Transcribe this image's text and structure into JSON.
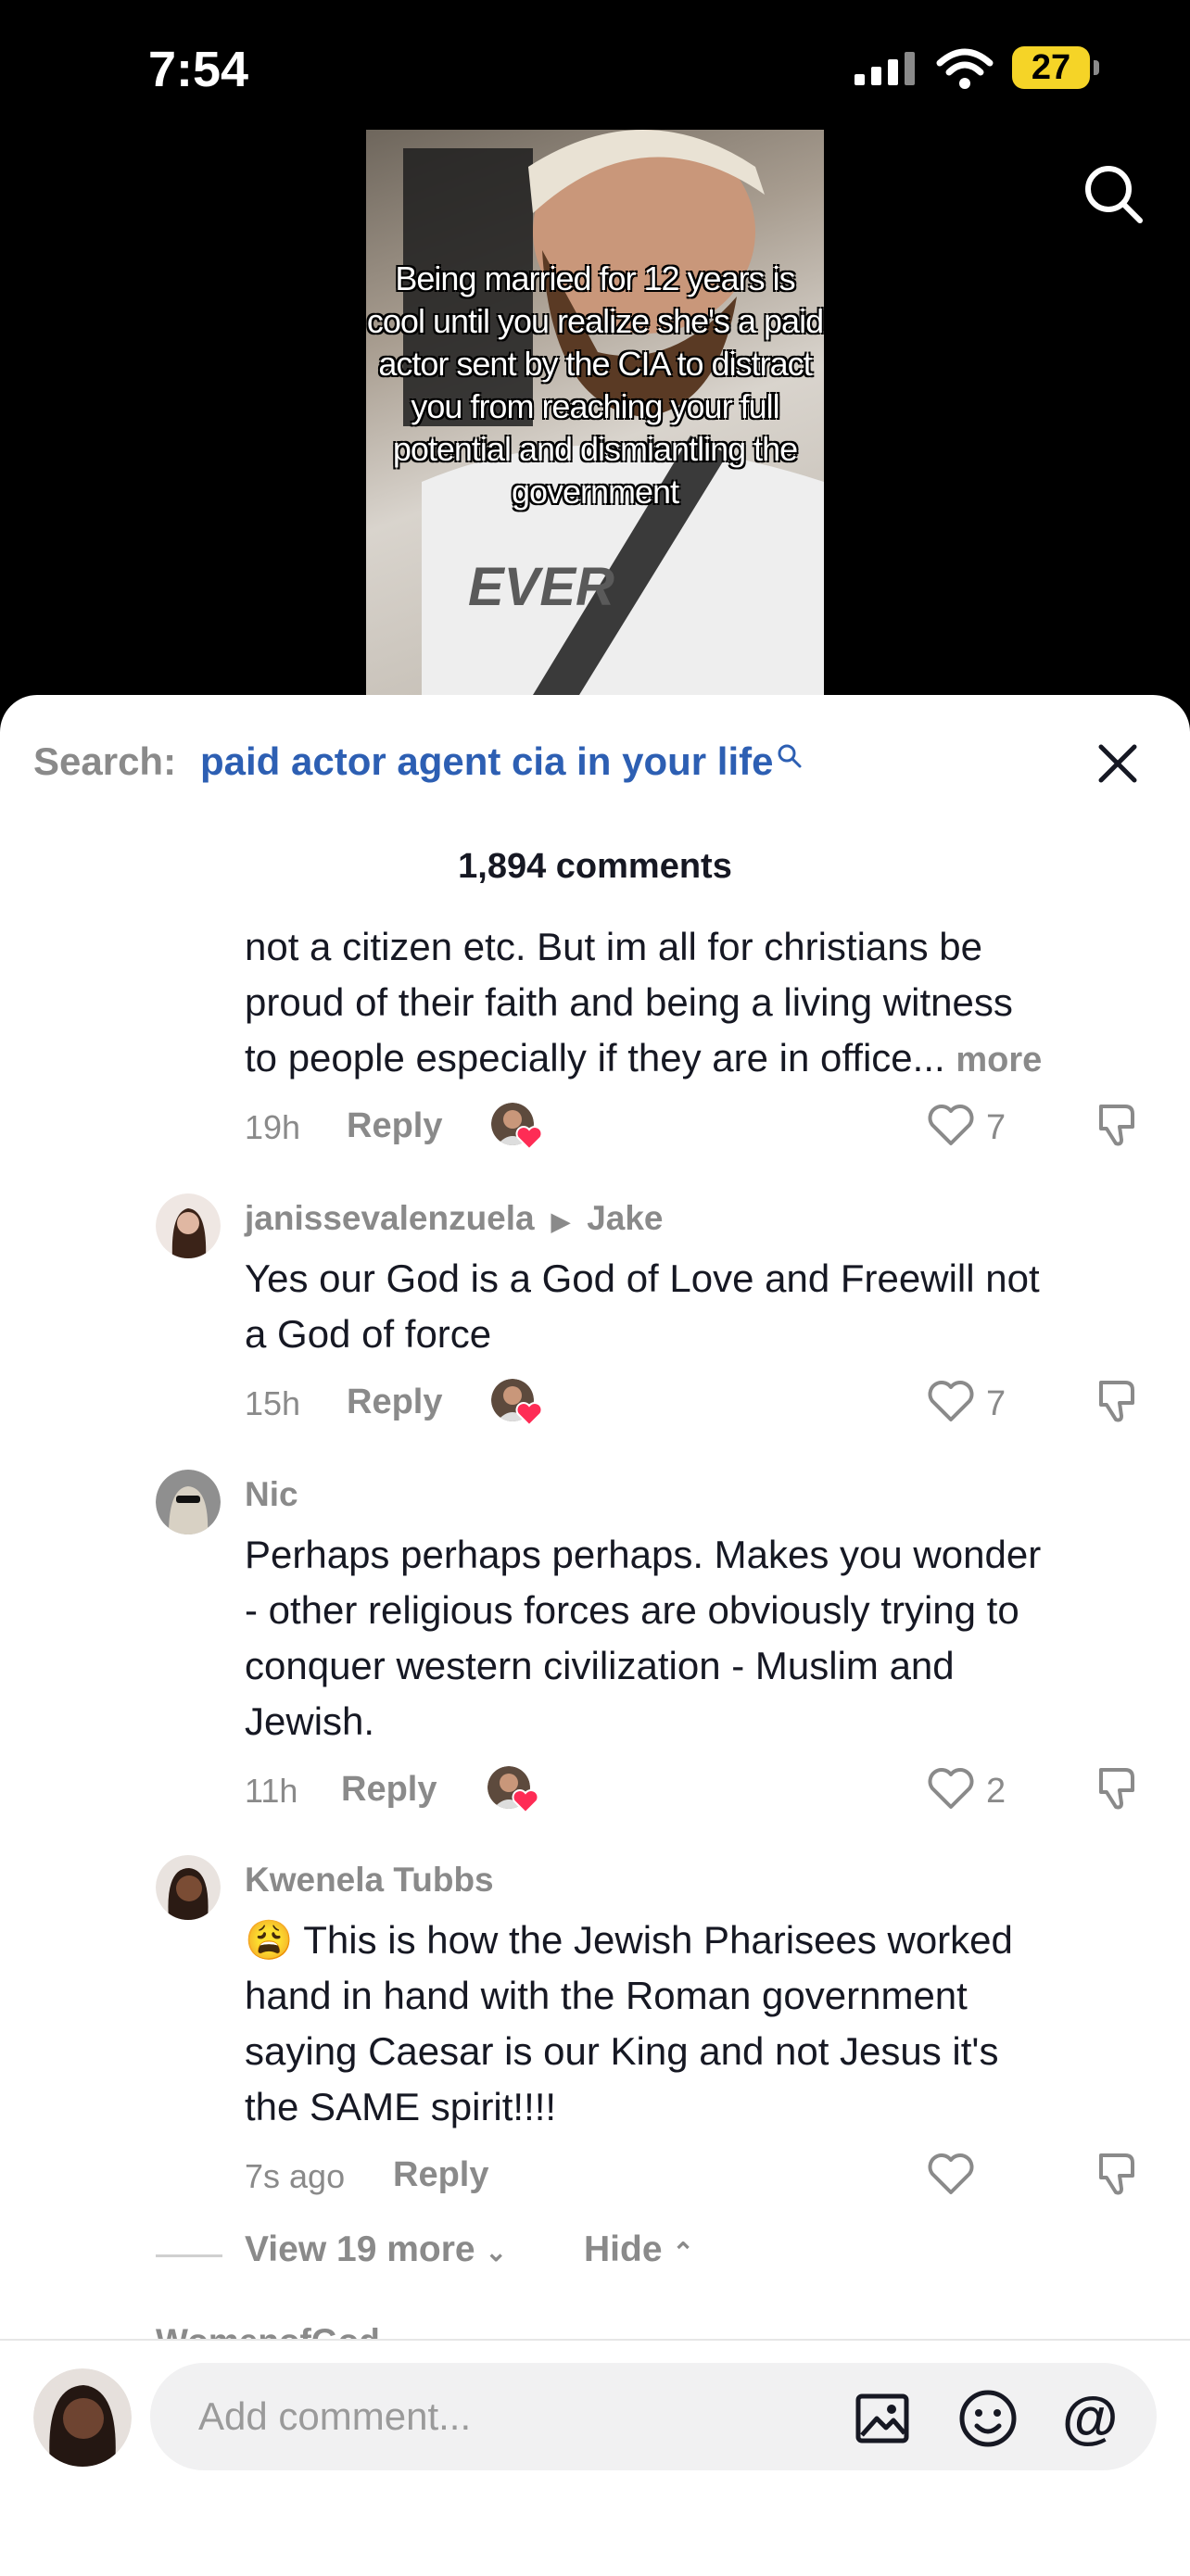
{
  "status_bar": {
    "time": "7:54",
    "battery": "27"
  },
  "video": {
    "caption": "Being married for 12 years is cool until you realize she's a paid actor sent by the CIA to distract you from reaching your full potential and dismiantling the government",
    "shirt_text": "EVER"
  },
  "search": {
    "label": "Search:",
    "query": "paid actor agent cia in your life"
  },
  "comments_count": "1,894 comments",
  "comments": [
    {
      "text_lines": [
        "not a citizen etc. But im all for christians be",
        "proud of their faith and being a living witness",
        "to people especially if they are in office..."
      ],
      "more": "more",
      "time": "19h",
      "reply": "Reply",
      "likes": "7"
    },
    {
      "user": "janissevalenzuela",
      "reply_to": "Jake",
      "text_lines": [
        "Yes our God is a God of Love and Freewill not",
        "a God of force"
      ],
      "time": "15h",
      "reply": "Reply",
      "likes": "7"
    },
    {
      "user": "Nic",
      "text_lines": [
        "Perhaps perhaps perhaps. Makes you wonder",
        "- other religious forces are obviously trying to",
        "conquer western civilization - Muslim and",
        "Jewish."
      ],
      "time": "11h",
      "reply": "Reply",
      "likes": "2"
    },
    {
      "user": "Kwenela Tubbs",
      "emoji": "😩",
      "text_lines": [
        "This is how the Jewish Pharisees worked",
        "hand in hand with the Roman government",
        "saying Caesar is our King and not Jesus it's",
        "the SAME spirit!!!!"
      ],
      "time": "7s ago",
      "reply": "Reply",
      "likes": ""
    }
  ],
  "thread": {
    "view_more": "View 19 more",
    "hide": "Hide"
  },
  "next_user_partial": "WomenofGod",
  "composer": {
    "placeholder": "Add comment..."
  },
  "icons": [
    "search-icon",
    "close-icon",
    "heart-icon",
    "dislike-icon",
    "image-icon",
    "emoji-icon",
    "mention-icon"
  ]
}
